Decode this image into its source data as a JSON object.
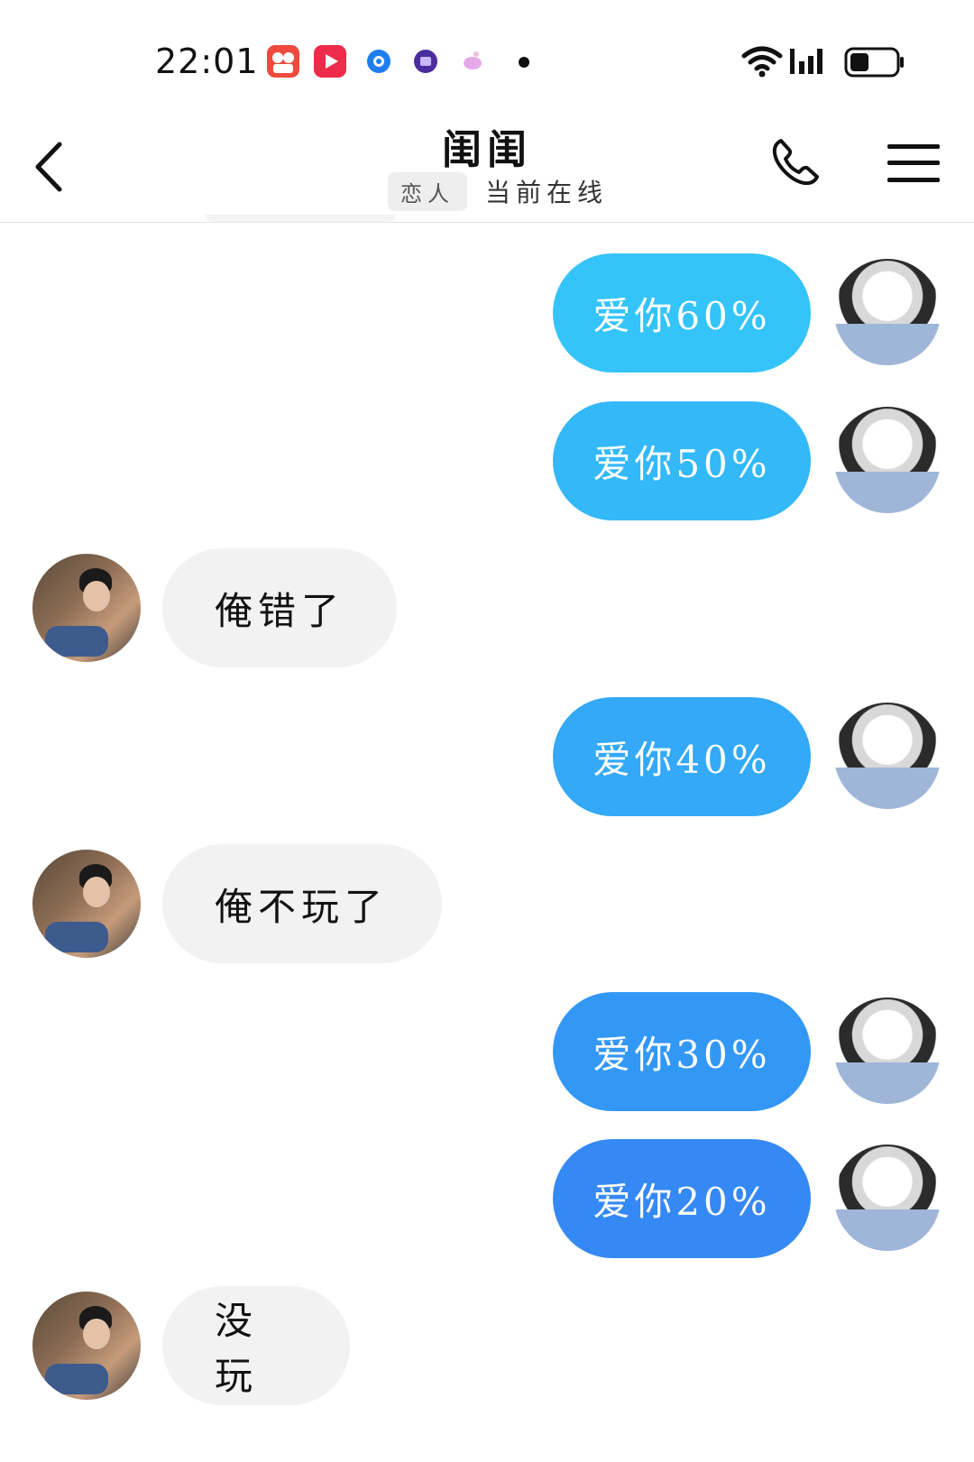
{
  "status_bar": {
    "time": "22:01",
    "icons": [
      "kuaishou-app-icon",
      "video-app-icon",
      "browser-app-icon",
      "purple-app-icon",
      "pink-app-icon",
      "notification-dot",
      "wifi-icon",
      "signal-icon",
      "battery-icon"
    ]
  },
  "header": {
    "title": "闺闺",
    "tag": "恋人",
    "status": "当前在线"
  },
  "messages": [
    {
      "side": "out",
      "text": "爱你60%",
      "color": "#34c4f9"
    },
    {
      "side": "out",
      "text": "爱你50%",
      "color": "#33b8f8"
    },
    {
      "side": "in",
      "text": "俺错了"
    },
    {
      "side": "out",
      "text": "爱你40%",
      "color": "#33a9f7"
    },
    {
      "side": "in",
      "text": "俺不玩了"
    },
    {
      "side": "out",
      "text": "爱你30%",
      "color": "#3398f5"
    },
    {
      "side": "out",
      "text": "爱你20%",
      "color": "#3589f4"
    },
    {
      "side": "in",
      "text": "没玩"
    }
  ]
}
